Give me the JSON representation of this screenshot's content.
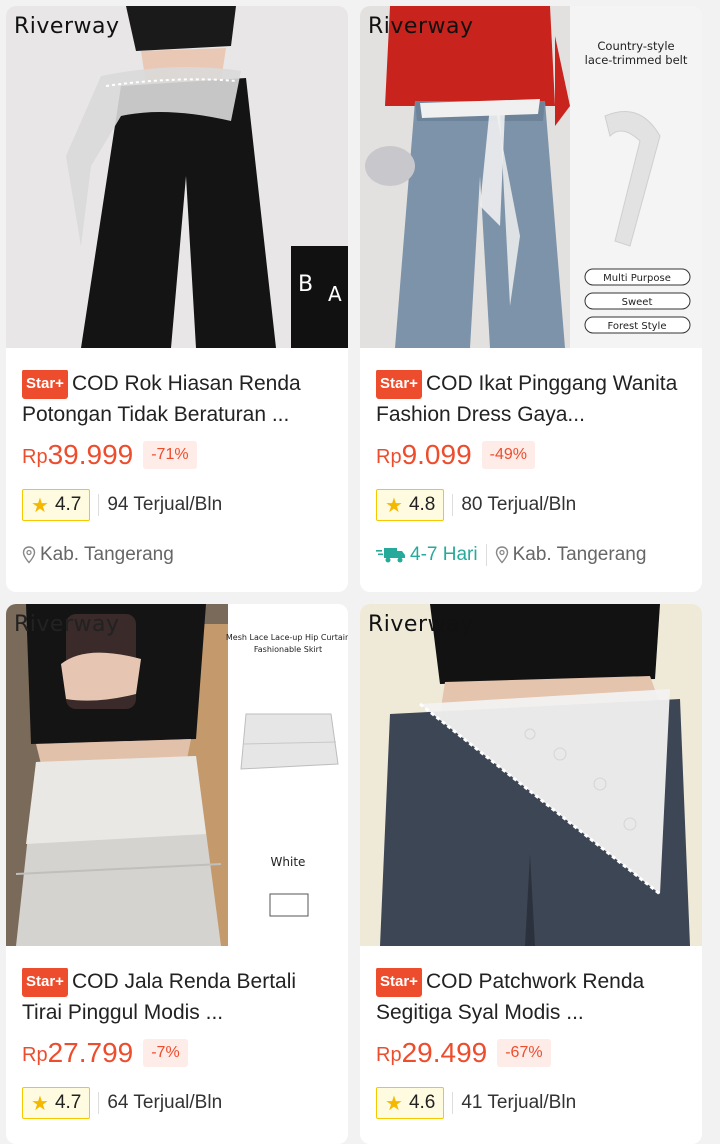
{
  "products": [
    {
      "brand": "Riverway",
      "badge": "Star+",
      "title": "COD Rok Hiasan Renda Potongan Tidak Beraturan ...",
      "currency": "Rp",
      "price": "39.999",
      "discount": "-71%",
      "rating": "4.7",
      "sold": "94 Terjual/Bln",
      "location": "Kab. Tangerang"
    },
    {
      "brand": "Riverway",
      "badge": "Star+",
      "title": "COD Ikat Pinggang Wanita Fashion Dress Gaya...",
      "currency": "Rp",
      "price": "9.099",
      "discount": "-49%",
      "rating": "4.8",
      "sold": "80 Terjual/Bln",
      "eta": "4-7 Hari",
      "location": "Kab. Tangerang",
      "image_text": {
        "heading": "Country-style lace-trimmed belt",
        "tags": [
          "Multi Purpose",
          "Sweet",
          "Forest Style"
        ]
      }
    },
    {
      "brand": "Riverway",
      "badge": "Star+",
      "title": "COD Jala Renda Bertali Tirai Pinggul Modis ...",
      "currency": "Rp",
      "price": "27.799",
      "discount": "-7%",
      "rating": "4.7",
      "sold": "64 Terjual/Bln",
      "image_text": {
        "heading": "Mesh Lace Lace-up Hip Curtain Fashionable Skirt",
        "color": "White"
      }
    },
    {
      "brand": "Riverway",
      "badge": "Star+",
      "title": "COD Patchwork Renda Segitiga Syal Modis ...",
      "currency": "Rp",
      "price": "29.499",
      "discount": "-67%",
      "rating": "4.6",
      "sold": "41 Terjual/Bln"
    }
  ],
  "colors": {
    "accent": "#ee4d2d",
    "rating_border": "#f5c800",
    "eta": "#26aa99"
  }
}
